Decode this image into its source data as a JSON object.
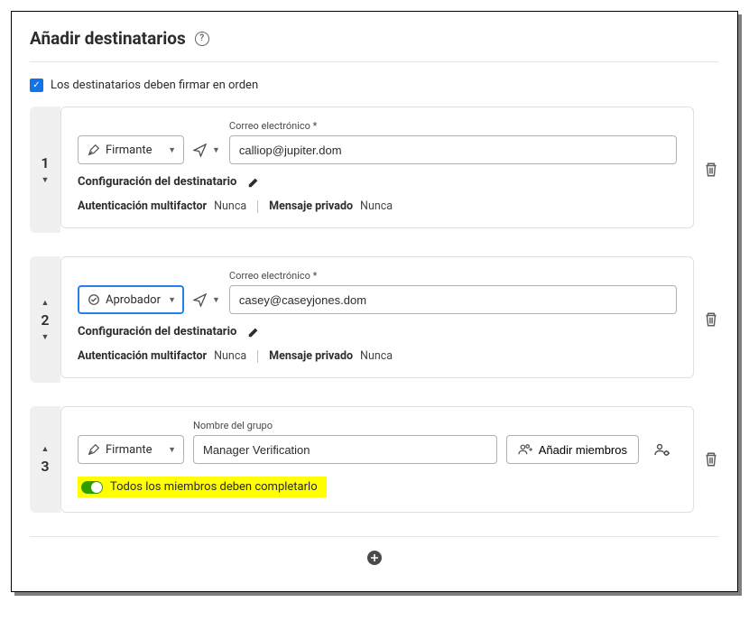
{
  "header": {
    "title": "Añadir destinatarios"
  },
  "order_option": {
    "label": "Los destinatarios deben firmar en orden"
  },
  "labels": {
    "email": "Correo electrónico *",
    "group_name": "Nombre del grupo",
    "recipient_config": "Configuración del destinatario",
    "mfa": "Autenticación multifactor",
    "private_msg": "Mensaje privado",
    "add_members": "Añadir miembros",
    "all_must_complete": "Todos los miembros deben completarlo"
  },
  "values": {
    "never": "Nunca"
  },
  "roles": {
    "signer": "Firmante",
    "approver": "Aprobador"
  },
  "recipients": [
    {
      "order": "1",
      "role_key": "signer",
      "email": "calliop@jupiter.dom",
      "mfa": "Nunca",
      "private_msg": "Nunca"
    },
    {
      "order": "2",
      "role_key": "approver",
      "email": "casey@caseyjones.dom",
      "mfa": "Nunca",
      "private_msg": "Nunca"
    },
    {
      "order": "3",
      "role_key": "signer",
      "group_name": "Manager Verification",
      "all_must_complete": true
    }
  ]
}
